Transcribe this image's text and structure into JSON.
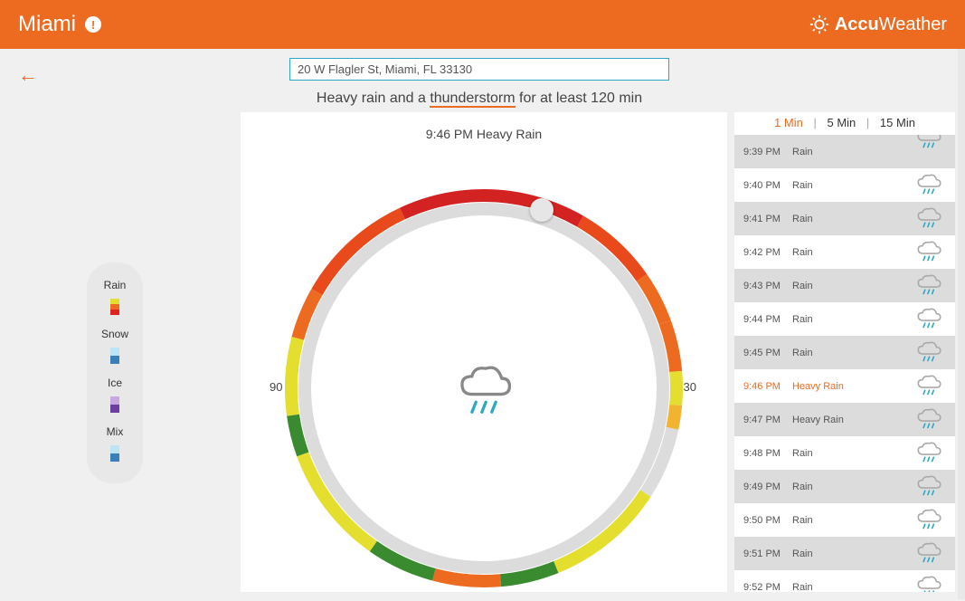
{
  "header": {
    "city": "Miami",
    "brand_prefix": "Accu",
    "brand_suffix": "Weather"
  },
  "search": {
    "value": "20 W Flagler St, Miami, FL 33130"
  },
  "summary": {
    "lead": "Heavy rain and a ",
    "highlight": "thunderstorm",
    "tail": " for at least 120 min"
  },
  "dial": {
    "current_time": "9:46 PM",
    "current_condition": "Heavy Rain",
    "label_left": "90",
    "label_right": "30"
  },
  "legend": {
    "items": [
      "Rain",
      "Snow",
      "Ice",
      "Mix"
    ]
  },
  "intervals": {
    "opt1": "1 Min",
    "opt5": "5 Min",
    "opt15": "15 Min",
    "active": "opt1"
  },
  "minute_rows": [
    {
      "time": "9:39 PM",
      "cond": "Rain",
      "alt": true,
      "current": false
    },
    {
      "time": "9:40 PM",
      "cond": "Rain",
      "alt": false,
      "current": false
    },
    {
      "time": "9:41 PM",
      "cond": "Rain",
      "alt": true,
      "current": false
    },
    {
      "time": "9:42 PM",
      "cond": "Rain",
      "alt": false,
      "current": false
    },
    {
      "time": "9:43 PM",
      "cond": "Rain",
      "alt": true,
      "current": false
    },
    {
      "time": "9:44 PM",
      "cond": "Rain",
      "alt": false,
      "current": false
    },
    {
      "time": "9:45 PM",
      "cond": "Rain",
      "alt": true,
      "current": false
    },
    {
      "time": "9:46 PM",
      "cond": "Heavy Rain",
      "alt": false,
      "current": true
    },
    {
      "time": "9:47 PM",
      "cond": "Heavy Rain",
      "alt": true,
      "current": false
    },
    {
      "time": "9:48 PM",
      "cond": "Rain",
      "alt": false,
      "current": false
    },
    {
      "time": "9:49 PM",
      "cond": "Rain",
      "alt": true,
      "current": false
    },
    {
      "time": "9:50 PM",
      "cond": "Rain",
      "alt": false,
      "current": false
    },
    {
      "time": "9:51 PM",
      "cond": "Rain",
      "alt": true,
      "current": false
    },
    {
      "time": "9:52 PM",
      "cond": "Rain",
      "alt": false,
      "current": false
    }
  ],
  "chart_data": {
    "type": "radial-timeline",
    "units": "minutes-ahead",
    "total_minutes": 120,
    "tick_left": 90,
    "tick_right": 30,
    "center_time": "9:46 PM",
    "center_condition": "Heavy Rain",
    "segments": [
      {
        "start_deg": 0,
        "end_deg": 30,
        "intensity": "heavy",
        "color": "#d22222"
      },
      {
        "start_deg": 30,
        "end_deg": 55,
        "intensity": "heavy",
        "color": "#e84a1b"
      },
      {
        "start_deg": 55,
        "end_deg": 70,
        "intensity": "moderate",
        "color": "#ed6b21"
      },
      {
        "start_deg": 70,
        "end_deg": 85,
        "intensity": "moderate",
        "color": "#ed6b21"
      },
      {
        "start_deg": 85,
        "end_deg": 95,
        "intensity": "light",
        "color": "#e4de2f"
      },
      {
        "start_deg": 95,
        "end_deg": 102,
        "intensity": "moderate",
        "color": "#f2b330"
      },
      {
        "start_deg": 102,
        "end_deg": 123,
        "intensity": "none",
        "color": "#dcdcdc"
      },
      {
        "start_deg": 123,
        "end_deg": 158,
        "intensity": "light",
        "color": "#e4de2f"
      },
      {
        "start_deg": 158,
        "end_deg": 175,
        "intensity": "mix",
        "color": "#3a8a2f"
      },
      {
        "start_deg": 175,
        "end_deg": 195,
        "intensity": "moderate",
        "color": "#ed6b21"
      },
      {
        "start_deg": 195,
        "end_deg": 215,
        "intensity": "mix",
        "color": "#3a8a2f"
      },
      {
        "start_deg": 215,
        "end_deg": 250,
        "intensity": "light",
        "color": "#e4de2f"
      },
      {
        "start_deg": 250,
        "end_deg": 262,
        "intensity": "mix",
        "color": "#3a8a2f"
      },
      {
        "start_deg": 262,
        "end_deg": 285,
        "intensity": "light",
        "color": "#e4de2f"
      },
      {
        "start_deg": 285,
        "end_deg": 300,
        "intensity": "moderate",
        "color": "#ed6b21"
      },
      {
        "start_deg": 300,
        "end_deg": 335,
        "intensity": "heavy",
        "color": "#e84a1b"
      },
      {
        "start_deg": 335,
        "end_deg": 360,
        "intensity": "heavy",
        "color": "#d22222"
      }
    ],
    "knob_deg": 18
  }
}
